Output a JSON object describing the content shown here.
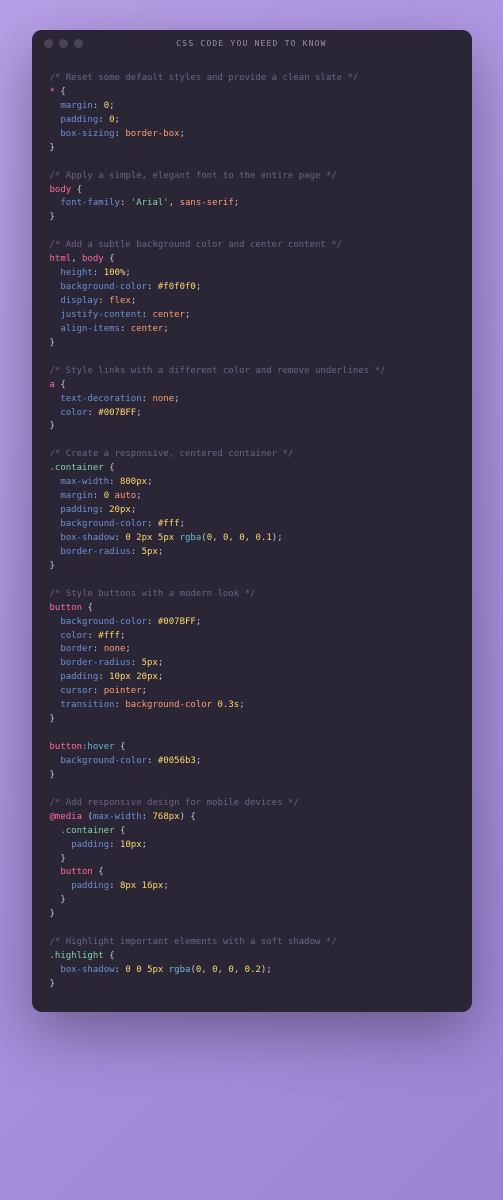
{
  "window": {
    "title": "CSS CODE YOU NEED TO KNOW"
  },
  "code": {
    "c1": "/* Reset some default styles and provide a clean slate */",
    "s1": "*",
    "p_margin": "margin",
    "p_padding": "padding",
    "p_boxsizing": "box-sizing",
    "v_0": "0",
    "v_borderbox": "border-box",
    "c2": "/* Apply a simple, elegant font to the entire page */",
    "s_body": "body",
    "p_fontfamily": "font-family",
    "v_arial": "'Arial'",
    "v_sans": "sans-serif",
    "c3": "/* Add a subtle background color and center content */",
    "s_html": "html",
    "p_height": "height",
    "v_100pct": "100%",
    "p_bgcolor": "background-color",
    "v_f0f0f0": "#f0f0f0",
    "p_display": "display",
    "v_flex": "flex",
    "p_justify": "justify-content",
    "v_center": "center",
    "p_alignitems": "align-items",
    "c4": "/* Style links with a different color and remove underlines */",
    "s_a": "a",
    "p_textdec": "text-decoration",
    "v_none": "none",
    "p_color": "color",
    "v_007bff": "#007BFF",
    "c5": "/* Create a responsive, centered container */",
    "s_container": ".container",
    "p_maxwidth": "max-width",
    "v_800px": "800px",
    "v_auto": "auto",
    "v_20px": "20px",
    "v_fff": "#fff",
    "p_boxshadow": "box-shadow",
    "fn_rgba": "rgba",
    "v_2px": "2px",
    "v_5px": "5px",
    "v_01": "0.1",
    "p_borderrad": "border-radius",
    "c6": "/* Style buttons with a modern look */",
    "s_button": "button",
    "p_border": "border",
    "v_10px": "10px",
    "p_cursor": "cursor",
    "v_pointer": "pointer",
    "p_transition": "transition",
    "v_03s": "0.3s",
    "v_bgcolor_word": "background-color",
    "s_hover": ":hover",
    "v_0056b3": "#0056b3",
    "c7": "/* Add responsive design for mobile devices */",
    "s_media": "@media",
    "v_maxwidth_word": "max-width",
    "v_768px": "768px",
    "v_8px": "8px",
    "v_16px": "16px",
    "c8": "/* Highlight important elements with a soft shadow */",
    "s_highlight": ".highlight",
    "v_02": "0.2",
    "brace_o": "{",
    "brace_c": "}",
    "comma": ",",
    "colon": ":",
    "semi": ";",
    "paren_o": "(",
    "paren_c": ")"
  }
}
